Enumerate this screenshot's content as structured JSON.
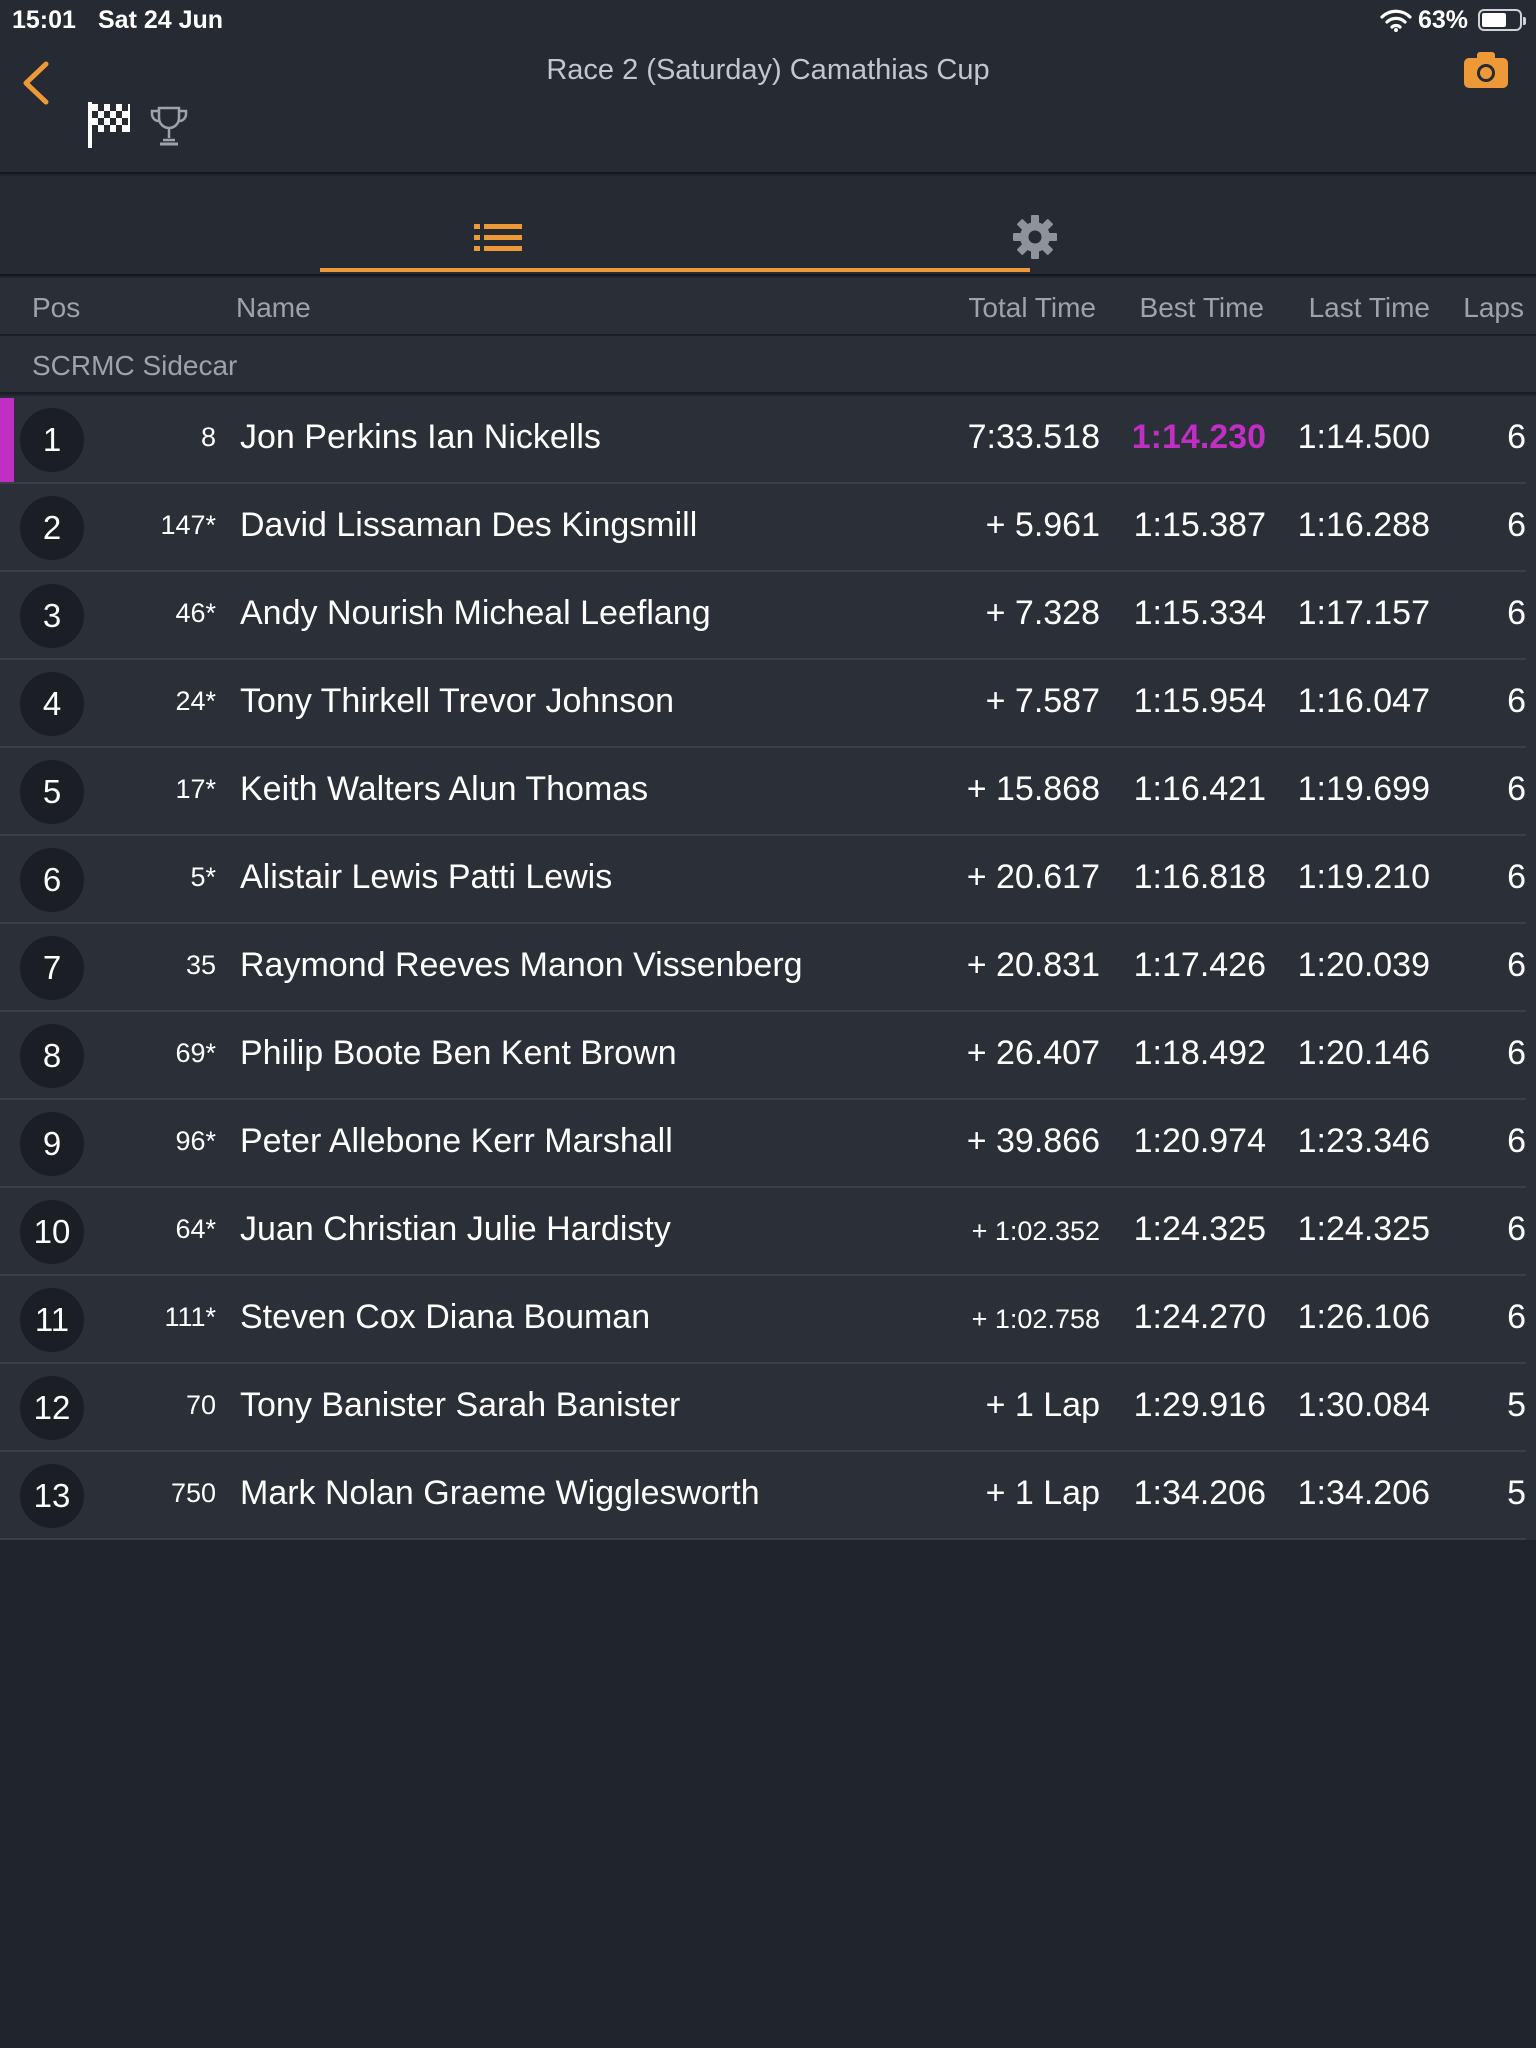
{
  "status_bar": {
    "time": "15:01",
    "date": "Sat 24 Jun",
    "battery": "63%"
  },
  "header": {
    "title": "Race 2 (Saturday) Camathias Cup"
  },
  "columns": {
    "pos": "Pos",
    "name": "Name",
    "total_time": "Total Time",
    "best_time": "Best Time",
    "last_time": "Last Time",
    "laps": "Laps"
  },
  "class_name": "SCRMC Sidecar",
  "colors": {
    "accent": "#ee9937",
    "fastest": "#c02ec4",
    "progress": "#36b4cc"
  },
  "results": [
    {
      "pos": "1",
      "num": "8",
      "name": "Jon Perkins Ian Nickells",
      "total": "7:33.518",
      "best": "1:14.230",
      "last": "1:14.500",
      "laps": "6",
      "name_fraction": 0.38
    },
    {
      "pos": "2",
      "num": "147*",
      "name": "David Lissaman Des Kingsmill",
      "total": "+ 5.961",
      "best": "1:15.387",
      "last": "1:16.288",
      "laps": "6",
      "name_fraction": 0.16
    },
    {
      "pos": "3",
      "num": "46*",
      "name": "Andy Nourish Micheal Leeflang",
      "total": "+ 7.328",
      "best": "1:15.334",
      "last": "1:17.157",
      "laps": "6",
      "name_fraction": 0.49
    },
    {
      "pos": "4",
      "num": "24*",
      "name": "Tony Thirkell Trevor Johnson",
      "total": "+ 7.587",
      "best": "1:15.954",
      "last": "1:16.047",
      "laps": "6",
      "name_fraction": 0.45
    },
    {
      "pos": "5",
      "num": "17*",
      "name": "Keith Walters Alun Thomas",
      "total": "+ 15.868",
      "best": "1:16.421",
      "last": "1:19.699",
      "laps": "6",
      "name_fraction": 0.45
    },
    {
      "pos": "6",
      "num": "5*",
      "name": "Alistair Lewis Patti Lewis",
      "total": "+ 20.617",
      "best": "1:16.818",
      "last": "1:19.210",
      "laps": "6",
      "name_fraction": 0.3
    },
    {
      "pos": "7",
      "num": "35",
      "name": "Raymond Reeves Manon Vissenberg",
      "total": "+ 20.831",
      "best": "1:17.426",
      "last": "1:20.039",
      "laps": "6",
      "name_fraction": 0.82
    },
    {
      "pos": "8",
      "num": "69*",
      "name": "Philip Boote Ben Kent Brown",
      "total": "+ 26.407",
      "best": "1:18.492",
      "last": "1:20.146",
      "laps": "6",
      "name_fraction": 0.21
    },
    {
      "pos": "9",
      "num": "96*",
      "name": "Peter Allebone Kerr Marshall",
      "total": "+ 39.866",
      "best": "1:20.974",
      "last": "1:23.346",
      "laps": "6",
      "name_fraction": 0.31
    },
    {
      "pos": "10",
      "num": "64*",
      "name": "Juan Christian Julie Hardisty",
      "total": "+ 1:02.352",
      "best": "1:24.325",
      "last": "1:24.325",
      "laps": "6",
      "name_fraction": 0.23
    },
    {
      "pos": "11",
      "num": "111*",
      "name": "Steven Cox Diana Bouman",
      "total": "+ 1:02.758",
      "best": "1:24.270",
      "last": "1:26.106",
      "laps": "6",
      "name_fraction": 0.45
    },
    {
      "pos": "12",
      "num": "70",
      "name": "Tony Banister Sarah Banister",
      "total": "+ 1 Lap",
      "best": "1:29.916",
      "last": "1:30.084",
      "laps": "5",
      "name_fraction": 0.36
    },
    {
      "pos": "13",
      "num": "750",
      "name": "Mark Nolan Graeme Wigglesworth",
      "total": "+ 1 Lap",
      "best": "1:34.206",
      "last": "1:34.206",
      "laps": "5",
      "name_fraction": 0.23
    }
  ]
}
